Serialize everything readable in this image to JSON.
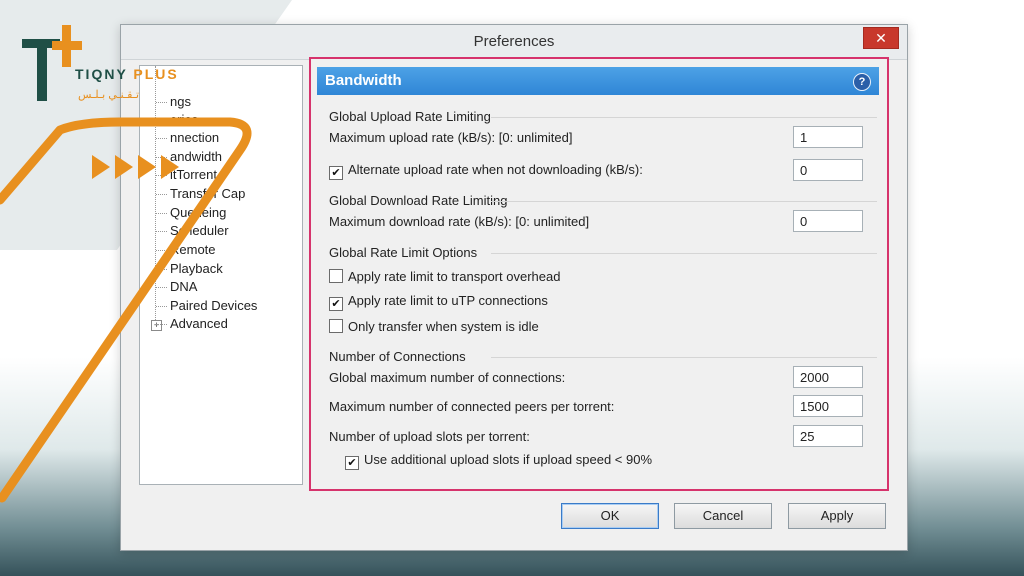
{
  "brand": {
    "name": "TIQNY",
    "plus": "PLUS",
    "arabic": "تـقـنـي   بـلـس"
  },
  "window": {
    "title": "Preferences",
    "close_symbol": "✕"
  },
  "sidebar": {
    "items": [
      {
        "label": "ngs"
      },
      {
        "label": "ories"
      },
      {
        "label": "nnection"
      },
      {
        "label": "andwidth"
      },
      {
        "label": "itTorrent"
      },
      {
        "label": "Transfer Cap"
      },
      {
        "label": "Queueing"
      },
      {
        "label": "Scheduler"
      },
      {
        "label": "Remote"
      },
      {
        "label": "Playback"
      },
      {
        "label": "DNA"
      },
      {
        "label": "Paired Devices"
      },
      {
        "label": "Advanced"
      }
    ],
    "expander_symbol": "+"
  },
  "panel": {
    "header": "Bandwidth",
    "help_symbol": "?",
    "upload": {
      "title": "Global Upload Rate Limiting",
      "max_label": "Maximum upload rate (kB/s): [0: unlimited]",
      "max_value": "1",
      "alt_label": "Alternate upload rate when not downloading (kB/s):",
      "alt_checked": true,
      "alt_value": "0"
    },
    "download": {
      "title": "Global Download Rate Limiting",
      "max_label": "Maximum download rate (kB/s): [0: unlimited]",
      "max_value": "0"
    },
    "options": {
      "title": "Global Rate Limit Options",
      "transport_label": "Apply rate limit to transport overhead",
      "transport_checked": false,
      "utp_label": "Apply rate limit to uTP connections",
      "utp_checked": true,
      "idle_label": "Only transfer when system is idle",
      "idle_checked": false
    },
    "connections": {
      "title": "Number of Connections",
      "global_label": "Global maximum number of connections:",
      "global_value": "2000",
      "peers_label": "Maximum number of connected peers per torrent:",
      "peers_value": "1500",
      "slots_label": "Number of upload slots per torrent:",
      "slots_value": "25",
      "extra_label": "Use additional upload slots if upload speed < 90%",
      "extra_checked": true
    }
  },
  "buttons": {
    "ok": "OK",
    "cancel": "Cancel",
    "apply": "Apply"
  },
  "colors": {
    "accent_orange": "#e8901f",
    "brand_green": "#1f4f46",
    "highlight_border": "#d6336c",
    "header_blue": "#2f86d6"
  }
}
